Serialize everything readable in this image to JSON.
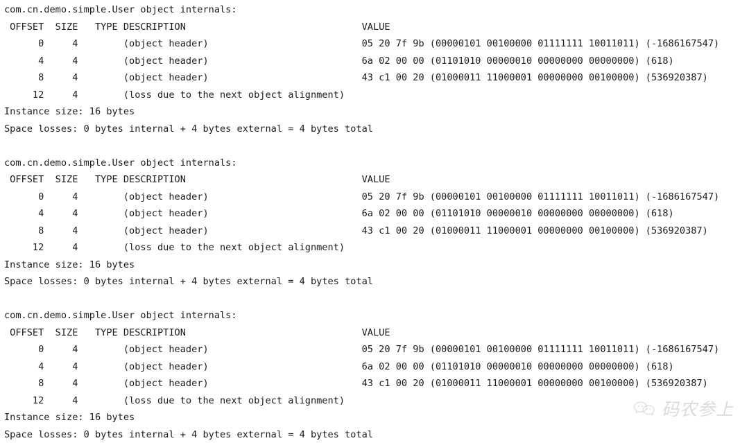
{
  "console": {
    "text_color": "#1b1b1b",
    "background_color": "#ffffff",
    "blocks": [
      {
        "title": "com.cn.demo.simple.User object internals:",
        "header": " OFFSET  SIZE   TYPE DESCRIPTION                               VALUE",
        "rows": [
          "      0     4        (object header)                           05 20 7f 9b (00000101 00100000 01111111 10011011) (-1686167547)",
          "      4     4        (object header)                           6a 02 00 00 (01101010 00000010 00000000 00000000) (618)",
          "      8     4        (object header)                           43 c1 00 20 (01000011 11000001 00000000 00100000) (536920387)",
          "     12     4        (loss due to the next object alignment)"
        ],
        "instance_size": "Instance size: 16 bytes",
        "space_losses": "Space losses: 0 bytes internal + 4 bytes external = 4 bytes total"
      },
      {
        "title": "com.cn.demo.simple.User object internals:",
        "header": " OFFSET  SIZE   TYPE DESCRIPTION                               VALUE",
        "rows": [
          "      0     4        (object header)                           05 20 7f 9b (00000101 00100000 01111111 10011011) (-1686167547)",
          "      4     4        (object header)                           6a 02 00 00 (01101010 00000010 00000000 00000000) (618)",
          "      8     4        (object header)                           43 c1 00 20 (01000011 11000001 00000000 00100000) (536920387)",
          "     12     4        (loss due to the next object alignment)"
        ],
        "instance_size": "Instance size: 16 bytes",
        "space_losses": "Space losses: 0 bytes internal + 4 bytes external = 4 bytes total"
      },
      {
        "title": "com.cn.demo.simple.User object internals:",
        "header": " OFFSET  SIZE   TYPE DESCRIPTION                               VALUE",
        "rows": [
          "      0     4        (object header)                           05 20 7f 9b (00000101 00100000 01111111 10011011) (-1686167547)",
          "      4     4        (object header)                           6a 02 00 00 (01101010 00000010 00000000 00000000) (618)",
          "      8     4        (object header)                           43 c1 00 20 (01000011 11000001 00000000 00100000) (536920387)",
          "     12     4        (loss due to the next object alignment)"
        ],
        "instance_size": "Instance size: 16 bytes",
        "space_losses": "Space losses: 0 bytes internal + 4 bytes external = 4 bytes total"
      }
    ]
  },
  "watermark": {
    "label": "码农参上",
    "icon": "wechat-logo-icon",
    "color": "#8a8a8a"
  }
}
